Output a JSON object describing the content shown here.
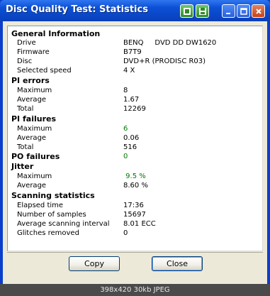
{
  "window": {
    "title": "Disc Quality Test: Statistics"
  },
  "sections": [
    {
      "heading": "General Information",
      "rows": [
        {
          "label": "Drive",
          "value": "BENQ     DVD DD DW1620"
        },
        {
          "label": "Firmware",
          "value": "B7T9"
        },
        {
          "label": "Disc",
          "value": "DVD+R (PRODISC R03)"
        },
        {
          "label": "Selected speed",
          "value": "4 X"
        }
      ]
    },
    {
      "heading": "PI errors",
      "rows": [
        {
          "label": "Maximum",
          "value": "8"
        },
        {
          "label": "Average",
          "value": "1.67"
        },
        {
          "label": "Total",
          "value": "12269"
        }
      ]
    },
    {
      "heading": "PI failures",
      "rows": [
        {
          "label": "Maximum",
          "value": "6"
        },
        {
          "label": "Average",
          "value": "0.06"
        },
        {
          "label": "Total",
          "value": "516"
        }
      ]
    },
    {
      "heading": "PO failures",
      "value": "0"
    },
    {
      "heading": "Jitter",
      "rows": [
        {
          "label": "Maximum",
          "value": " 9.5 %"
        },
        {
          "label": "Average",
          "value": "8.60 %"
        }
      ]
    },
    {
      "heading": "Scanning statistics",
      "rows": [
        {
          "label": "Elapsed time",
          "value": "17:36"
        },
        {
          "label": "Number of samples",
          "value": "15697"
        },
        {
          "label": "Average scanning interval",
          "value": "8.01 ECC"
        },
        {
          "label": "Glitches removed",
          "value": "0"
        }
      ]
    }
  ],
  "buttons": {
    "copy": "Copy",
    "close": "Close"
  },
  "caption": "398x420 30kb JPEG",
  "colors": {
    "accent_value": "#007a00",
    "title_bar": "#0c51d6",
    "dialog_bg": "#ece9d8"
  },
  "icons": [
    "app-icon",
    "save-icon",
    "minimize-icon",
    "maximize-icon",
    "close-icon"
  ]
}
